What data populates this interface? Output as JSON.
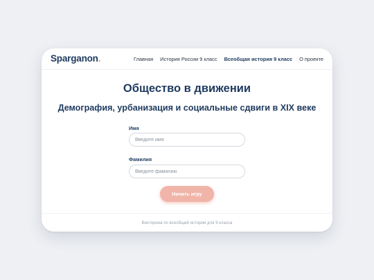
{
  "header": {
    "logo_text": "Sparganon",
    "logo_dot": ".",
    "nav": [
      {
        "label": "Главная",
        "active": false
      },
      {
        "label": "История России 9 класс",
        "active": false
      },
      {
        "label": "Всеобщая история 9 класс",
        "active": true
      },
      {
        "label": "О проекте",
        "active": false
      }
    ]
  },
  "main": {
    "title": "Общество в движении",
    "subtitle": "Демография, урбанизация и социальные сдвиги в XIX веке"
  },
  "form": {
    "first_name_label": "Имя",
    "first_name_placeholder": "Введите имя",
    "first_name_value": "",
    "last_name_label": "Фамилия",
    "last_name_placeholder": "Введите фамилию",
    "last_name_value": "",
    "start_button": "Начать игру"
  },
  "footer": {
    "text": "Викторина по всеобщей истории для 9 класса"
  },
  "colors": {
    "brand_navy": "#1e3a5f",
    "accent_salmon": "#f0b4a8",
    "logo_dot": "#e8917f",
    "background": "#eef0f4"
  }
}
